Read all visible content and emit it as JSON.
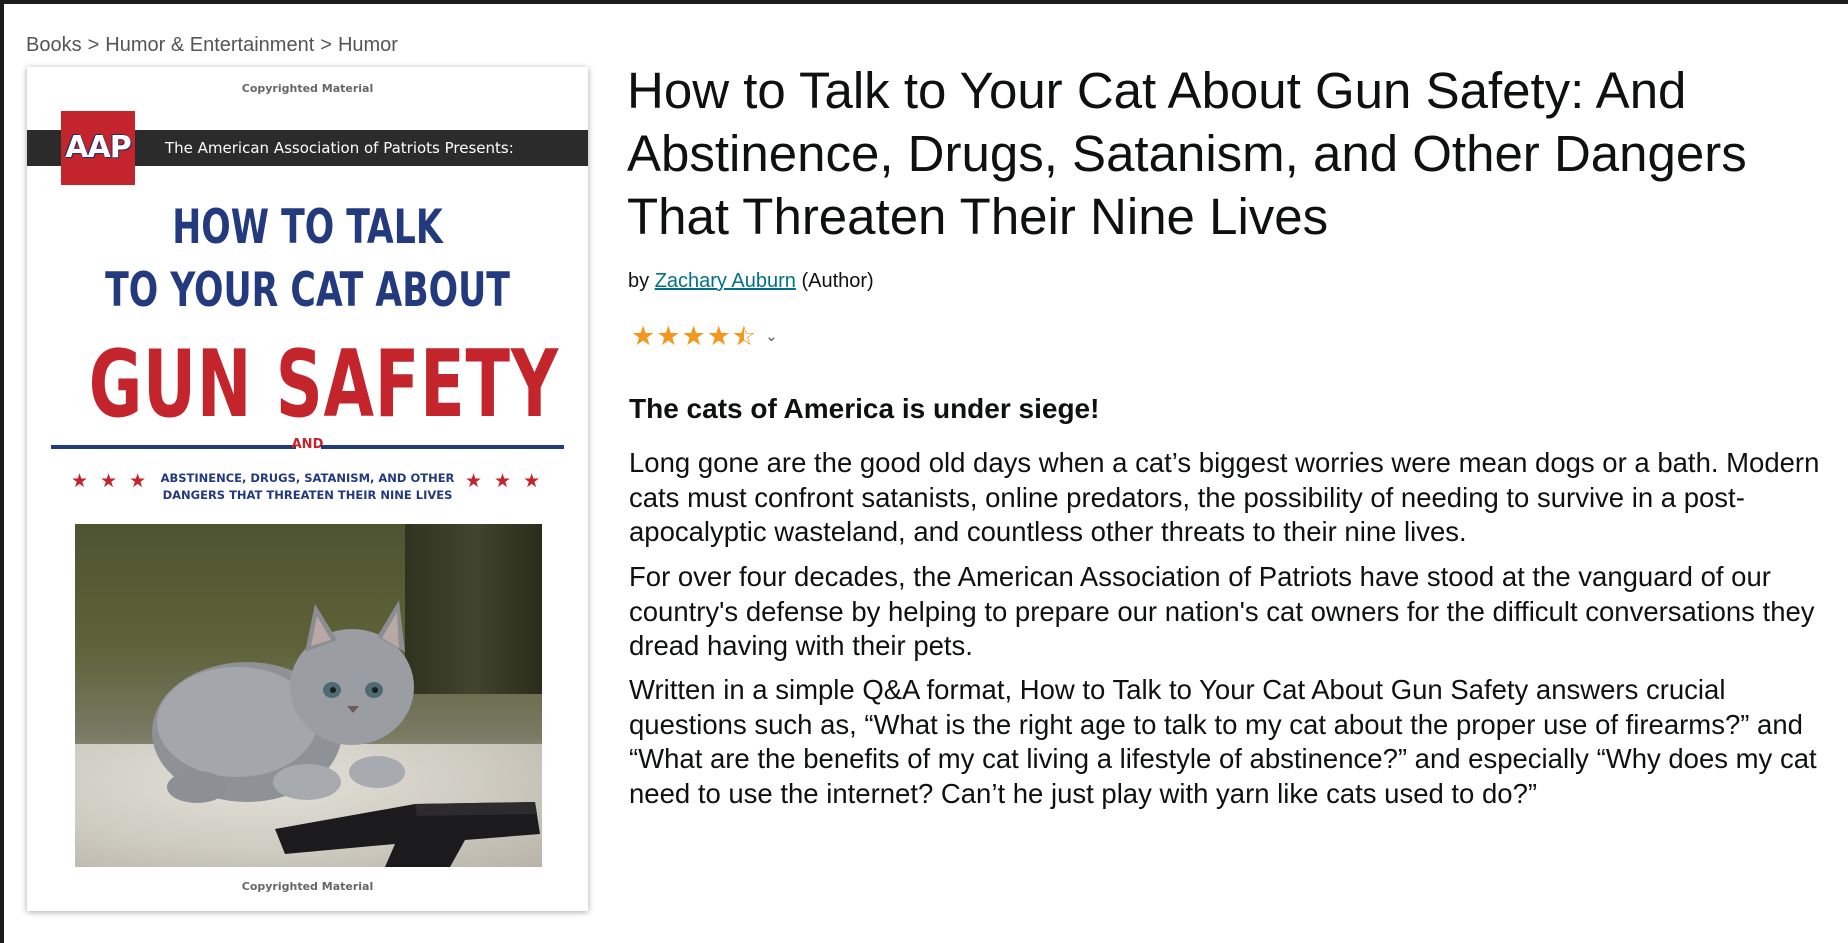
{
  "breadcrumb": {
    "items": [
      "Books",
      "Humor & Entertainment",
      "Humor"
    ],
    "separator": ">"
  },
  "cover": {
    "copyright_top": "Copyrighted Material",
    "copyright_bottom": "Copyrighted Material",
    "logo_text": "AAP",
    "banner_text": "The American Association of Patriots Presents:",
    "title_line1": "HOW TO TALK",
    "title_line2": "TO YOUR CAT ABOUT",
    "title_line3": "GUN SAFETY",
    "and_text": "AND",
    "stars_left": "★★★",
    "stars_right": "★★★",
    "subtitle_line1": "ABSTINENCE, DRUGS, SATANISM, AND OTHER",
    "subtitle_line2": "DANGERS THAT THREATEN THEIR NINE LIVES",
    "colors": {
      "red": "#c4242b",
      "blue": "#233a7e",
      "banner": "#2b2b2b"
    }
  },
  "product": {
    "title": "How to Talk to Your Cat About Gun Safety: And Abstinence, Drugs, Satanism, and Other Dangers That Threaten Their Nine Lives",
    "by_prefix": "by",
    "author": "Zachary Auburn",
    "author_role": "(Author)",
    "rating_stars": 4.5,
    "rating_icon": "star-icon",
    "chevron_icon": "chevron-down-icon"
  },
  "description": {
    "headline": "The cats of America is under siege!",
    "paragraphs": [
      "Long gone are the good old days when a cat’s biggest worries were mean dogs or a bath. Modern cats must confront satanists, online predators, the possibility of needing to survive in a post-apocalyptic wasteland, and countless other threats to their nine lives.",
      "For over four decades, the American Association of Patriots have stood at the vanguard of our country's defense by helping to prepare our nation's cat owners for the difficult conversations they dread having with their pets.",
      "Written in a simple Q&A format, How to Talk to Your Cat About Gun Safety answers crucial questions such as, “What is the right age to talk to my cat about the proper use of firearms?” and “What are the benefits of my cat living a lifestyle of abstinence?” and especially “Why does my cat need to use the internet? Can’t he just play with yarn like cats used to do?”"
    ]
  },
  "colors": {
    "link": "#007185",
    "star": "#f5961f",
    "text": "#0f1111",
    "breadcrumb": "#555555"
  }
}
